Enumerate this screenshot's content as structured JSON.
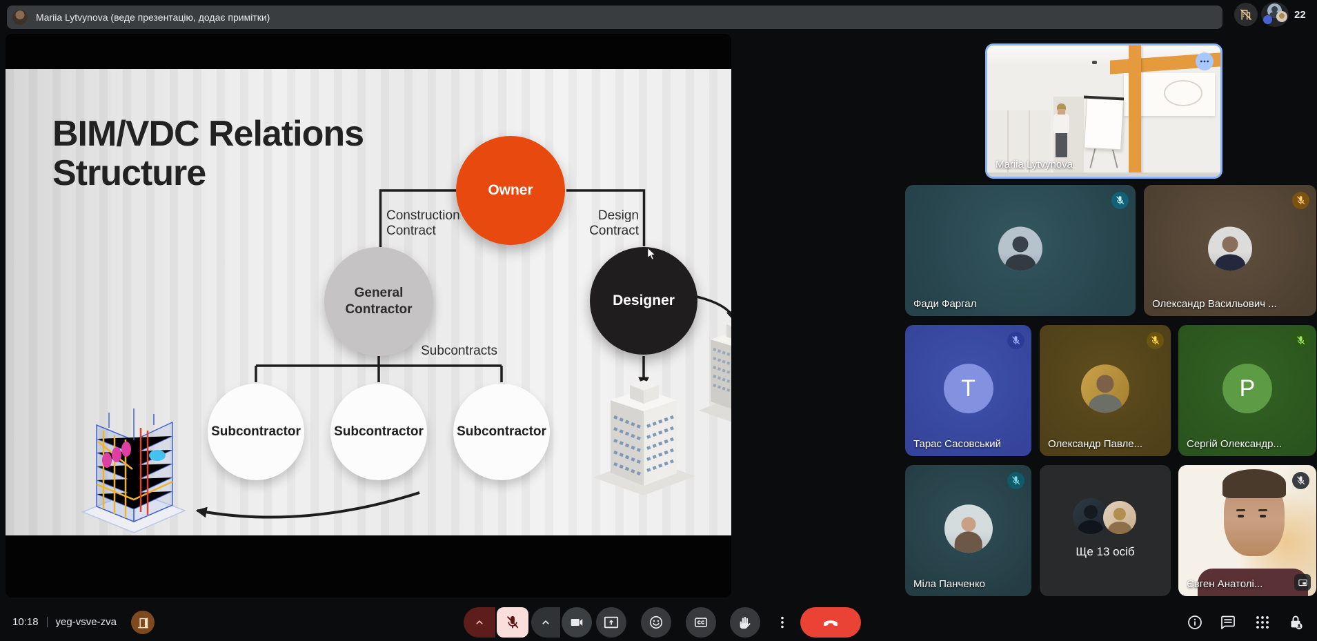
{
  "top_bar": {
    "presenter_status": "Mariia Lytvynova (веде презентацію, додає примітки)",
    "participant_count": "22"
  },
  "slide": {
    "title_line1": "BIM/VDC Relations",
    "title_line2": "Structure",
    "owner_label": "Owner",
    "general_contractor_line1": "General",
    "general_contractor_line2": "Contractor",
    "designer_label": "Designer",
    "subcontractor_label": "Subcontractor",
    "construction_contract_line1": "Construction",
    "construction_contract_line2": "Contract",
    "design_contract_line1": "Design",
    "design_contract_line2": "Contract",
    "subcontracts_label": "Subcontracts",
    "colors": {
      "owner_circle": "#e8490e",
      "designer_circle": "#201d1e",
      "general_contractor_circle": "#c5c3c4",
      "subcontractor_circle": "#fcfcfc",
      "connector_line": "#1d1d1d"
    }
  },
  "participants": [
    {
      "name": "Mariia Lytvynova"
    },
    {
      "name": "Фади Фаргал"
    },
    {
      "name": "Олександр Васильович ..."
    },
    {
      "name": "Тарас Сасовський",
      "initial": "Т"
    },
    {
      "name": "Олександр Павле..."
    },
    {
      "name": "Сергій Олександр...",
      "initial": "Р"
    },
    {
      "name": "Міла Панченко"
    },
    {
      "label": "Ще 13 осіб"
    },
    {
      "name": "Євген Анатолі..."
    }
  ],
  "toolbar": {
    "time": "10:18",
    "meeting_code": "yeg-vsve-zva"
  },
  "colors": {
    "active_speaker_border": "#8ab4f8",
    "end_call_button": "#ea4336",
    "muted_mic_chip": "#f9dedc"
  }
}
